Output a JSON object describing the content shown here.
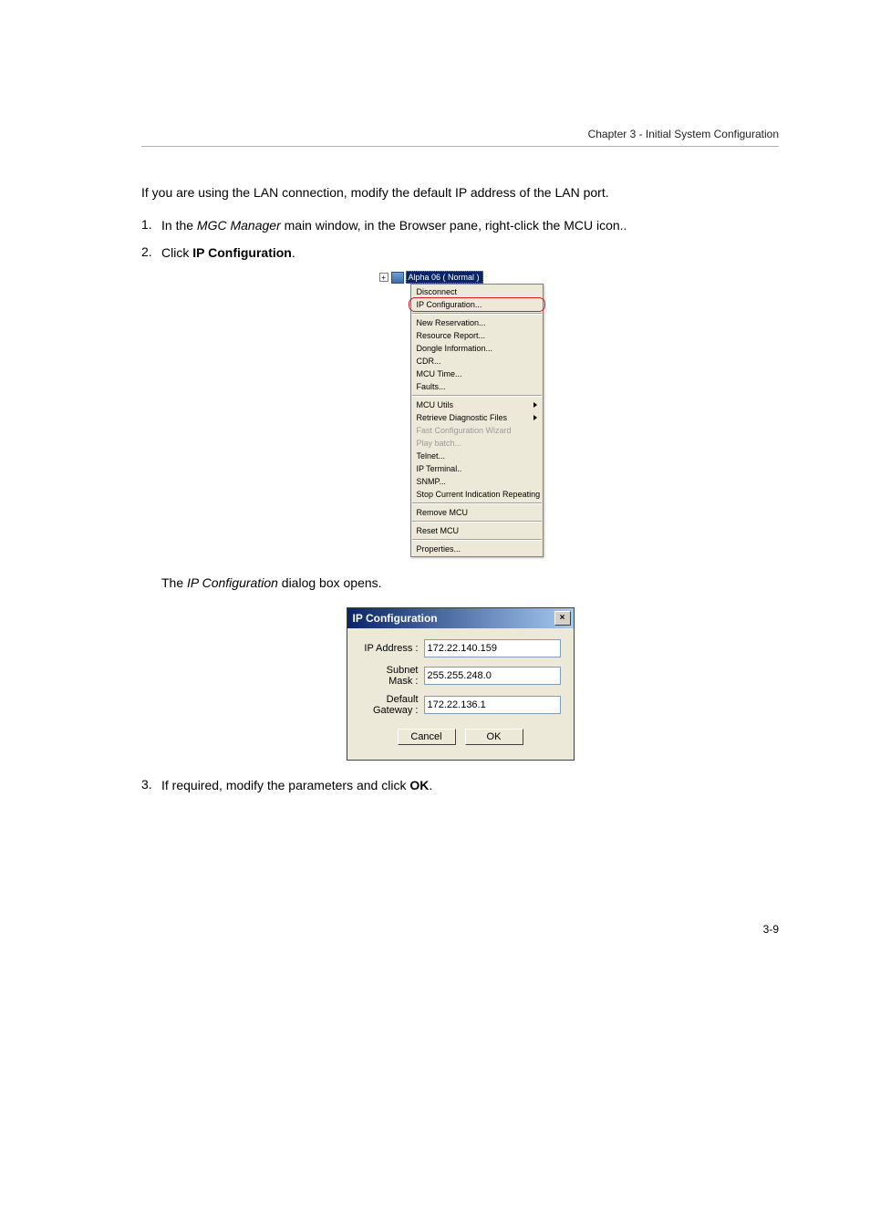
{
  "header": {
    "chapter_line": "Chapter 3 - Initial System Configuration"
  },
  "intro": "If you are using the LAN connection, modify the default IP address of the LAN port.",
  "steps": [
    {
      "num": "1.",
      "text_a": "In the ",
      "em": "MGC Manager",
      "text_b": " main window, in the Browser pane, right-click the MCU icon.."
    },
    {
      "num": "2.",
      "text_a": "Click ",
      "bold": "IP Configuration",
      "text_b": "."
    }
  ],
  "after_menu_text_a": "The ",
  "after_menu_em": "IP Configuration",
  "after_menu_text_b": " dialog box opens.",
  "context_menu": {
    "tree_label": "Alpha 06   ( Normal )",
    "sections": [
      [
        {
          "label": "Disconnect",
          "disabled": false,
          "submenu": false
        },
        {
          "label": "IP Configuration...",
          "disabled": false,
          "submenu": false,
          "callout": true
        }
      ],
      [
        {
          "label": "New Reservation...",
          "disabled": false,
          "submenu": false
        },
        {
          "label": "Resource Report...",
          "disabled": false,
          "submenu": false
        },
        {
          "label": "Dongle Information...",
          "disabled": false,
          "submenu": false
        },
        {
          "label": "CDR...",
          "disabled": false,
          "submenu": false
        },
        {
          "label": "MCU Time...",
          "disabled": false,
          "submenu": false
        },
        {
          "label": "Faults...",
          "disabled": false,
          "submenu": false
        }
      ],
      [
        {
          "label": "MCU Utils",
          "disabled": false,
          "submenu": true
        },
        {
          "label": "Retrieve Diagnostic Files",
          "disabled": false,
          "submenu": true
        },
        {
          "label": "Fast Configuration Wizard",
          "disabled": true,
          "submenu": false
        },
        {
          "label": "Play batch...",
          "disabled": true,
          "submenu": false
        },
        {
          "label": "Telnet...",
          "disabled": false,
          "submenu": false
        },
        {
          "label": "IP Terminal..",
          "disabled": false,
          "submenu": false
        },
        {
          "label": "SNMP...",
          "disabled": false,
          "submenu": false
        },
        {
          "label": "Stop Current Indication Repeating",
          "disabled": false,
          "submenu": false
        }
      ],
      [
        {
          "label": "Remove MCU",
          "disabled": false,
          "submenu": false
        }
      ],
      [
        {
          "label": "Reset MCU",
          "disabled": false,
          "submenu": false
        }
      ],
      [
        {
          "label": "Properties...",
          "disabled": false,
          "submenu": false
        }
      ]
    ]
  },
  "dialog": {
    "title": "IP Configuration",
    "fields": [
      {
        "label": "IP Address :",
        "value": "172.22.140.159"
      },
      {
        "label": "Subnet Mask :",
        "value": "255.255.248.0"
      },
      {
        "label": "Default Gateway :",
        "value": "172.22.136.1"
      }
    ],
    "buttons": {
      "cancel": "Cancel",
      "ok": "OK"
    }
  },
  "step3": {
    "num": "3.",
    "text": "If required, modify the parameters and click "
  },
  "ok_bold": "OK",
  "page_number": "3-9"
}
